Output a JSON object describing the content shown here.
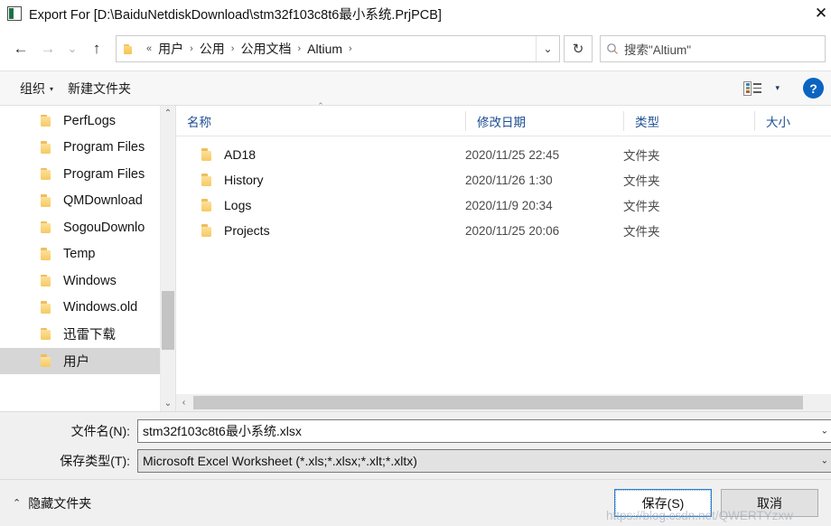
{
  "window": {
    "title": "Export For [D:\\BaiduNetdiskDownload\\stm32f103c8t6最小系统.PrjPCB]",
    "icon": "app-icon",
    "close_label": "✕"
  },
  "nav": {
    "back": "←",
    "forward": "→",
    "recent": "⌄",
    "up": "↑",
    "address_prefix": "«",
    "breadcrumbs": [
      {
        "label": "用户"
      },
      {
        "label": "公用"
      },
      {
        "label": "公用文档"
      },
      {
        "label": "Altium"
      }
    ],
    "separator": "›",
    "address_dropdown": "⌄",
    "refresh": "↻"
  },
  "search": {
    "placeholder": "搜索\"Altium\"",
    "icon": "search-icon"
  },
  "toolbar": {
    "organize_label": "组织",
    "organize_caret": "▾",
    "new_folder_label": "新建文件夹",
    "view_caret": "▾",
    "help_label": "?"
  },
  "sidebar": {
    "items": [
      {
        "label": "PerfLogs",
        "selected": false
      },
      {
        "label": "Program Files",
        "selected": false
      },
      {
        "label": "Program Files",
        "selected": false
      },
      {
        "label": "QMDownload",
        "selected": false
      },
      {
        "label": "SogouDownlo",
        "selected": false
      },
      {
        "label": "Temp",
        "selected": false
      },
      {
        "label": "Windows",
        "selected": false
      },
      {
        "label": "Windows.old",
        "selected": false
      },
      {
        "label": "迅雷下载",
        "selected": false
      },
      {
        "label": "用户",
        "selected": true
      }
    ],
    "scroll_up": "⌃",
    "scroll_down": "⌄"
  },
  "filelist": {
    "columns": {
      "name": "名称",
      "date": "修改日期",
      "type": "类型",
      "size": "大小",
      "sort_caret": "⌃"
    },
    "rows": [
      {
        "name": "AD18",
        "date": "2020/11/25 22:45",
        "type": "文件夹",
        "size": ""
      },
      {
        "name": "History",
        "date": "2020/11/26 1:30",
        "type": "文件夹",
        "size": ""
      },
      {
        "name": "Logs",
        "date": "2020/11/9 20:34",
        "type": "文件夹",
        "size": ""
      },
      {
        "name": "Projects",
        "date": "2020/11/25 20:06",
        "type": "文件夹",
        "size": ""
      }
    ],
    "hscroll_left": "‹"
  },
  "form": {
    "filename_label": "文件名(N):",
    "filename_value": "stm32f103c8t6最小系统.xlsx",
    "filename_caret": "⌄",
    "filetype_label": "保存类型(T):",
    "filetype_value": "Microsoft Excel Worksheet (*.xls;*.xlsx;*.xlt;*.xltx)",
    "filetype_caret": "⌄"
  },
  "footer": {
    "hide_folders_caret": "⌃",
    "hide_folders_label": "隐藏文件夹",
    "save_label": "保存(S)",
    "cancel_label": "取消"
  },
  "watermark": {
    "text": "https://blog.csdn.net/QWERTYzxw"
  },
  "colors": {
    "accent": "#0c64c0",
    "default_button_border": "#2a7fd4",
    "column_header_text": "#1d4f91",
    "selection": "#d6d6d6",
    "folder_yellow": "#f6ca63"
  }
}
